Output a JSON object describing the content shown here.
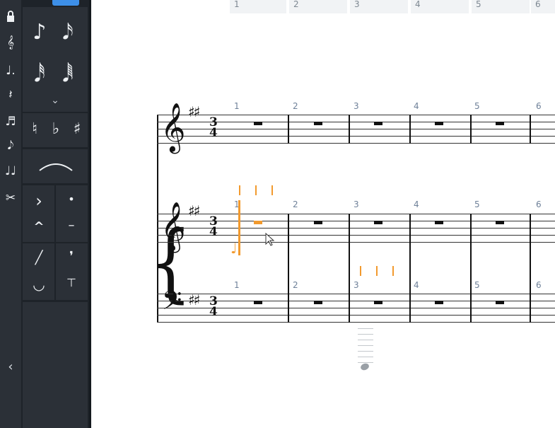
{
  "toolbar": {
    "items": [
      {
        "name": "lock-icon",
        "glyph": "🔒"
      },
      {
        "name": "clef-g-icon",
        "glyph": "𝄞"
      },
      {
        "name": "dotted-note-icon",
        "glyph": "♩."
      },
      {
        "name": "quarter-rest-icon",
        "glyph": "𝄽"
      },
      {
        "name": "beamed-notes-icon",
        "glyph": "♬"
      },
      {
        "name": "grace-note-icon",
        "glyph": "𝅘𝅥𝅮"
      },
      {
        "name": "two-notes-icon",
        "glyph": "♩♩"
      },
      {
        "name": "scissors-icon",
        "glyph": "✂"
      }
    ],
    "collapse_glyph": "‹"
  },
  "palette": {
    "notes": [
      "♪",
      "𝅘𝅥𝅯",
      "𝅘𝅥𝅰",
      "𝅘𝅥𝅱"
    ],
    "expand_glyph": "⌄",
    "accidentals": [
      "♮",
      "♭",
      "♯"
    ],
    "articulations": [
      "›",
      "•",
      "^",
      "–",
      "╱",
      "❜",
      "◡",
      "⊤"
    ]
  },
  "score": {
    "ruler": [
      "1",
      "2",
      "3",
      "4",
      "5",
      "6"
    ],
    "measure_numbers": [
      "1",
      "2",
      "3",
      "4",
      "5",
      "6"
    ],
    "key_signature": "♯♯",
    "time_signature": {
      "top": "3",
      "bottom": "4"
    },
    "clefs": {
      "treble": "𝄞",
      "bass": "𝄢"
    },
    "highlight_color": "#f29a2e"
  }
}
